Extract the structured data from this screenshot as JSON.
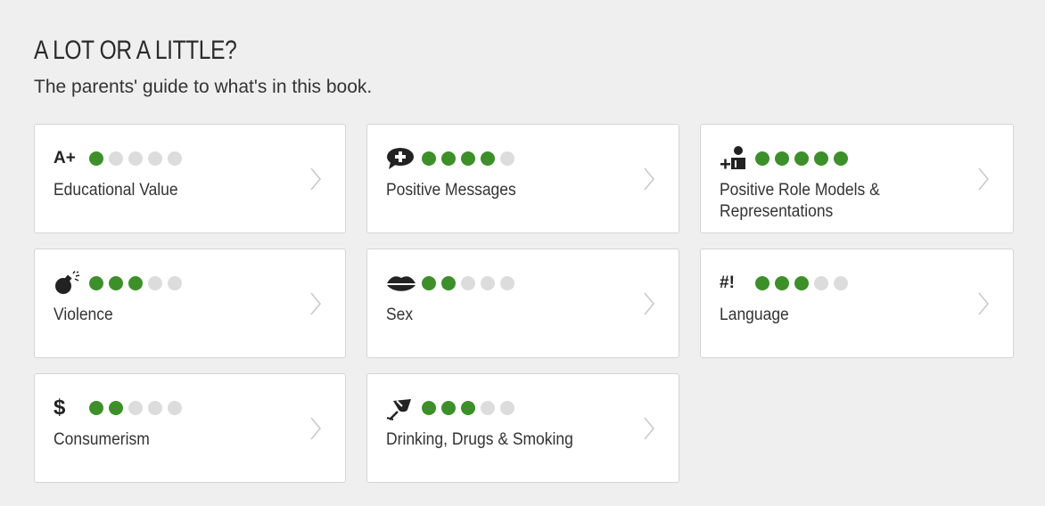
{
  "header": {
    "title": "A LOT OR A LITTLE?",
    "subtitle": "The parents' guide to what's in this book."
  },
  "colors": {
    "dot_on": "#3d8f2a",
    "dot_off": "#dcdcdc",
    "card_bg": "#ffffff",
    "page_bg": "#efefef"
  },
  "categories": [
    {
      "label": "Educational Value",
      "icon_text": "A+",
      "icon": "educational-value-icon",
      "rating": 1,
      "max": 5
    },
    {
      "label": "Positive Messages",
      "icon_text": "",
      "icon": "speech-bubble-plus-icon",
      "rating": 4,
      "max": 5
    },
    {
      "label": "Positive Role Models & Representations",
      "icon_text": "",
      "icon": "person-plus-icon",
      "rating": 5,
      "max": 5
    },
    {
      "label": "Violence",
      "icon_text": "",
      "icon": "bomb-icon",
      "rating": 3,
      "max": 5
    },
    {
      "label": "Sex",
      "icon_text": "",
      "icon": "lips-icon",
      "rating": 2,
      "max": 5
    },
    {
      "label": "Language",
      "icon_text": "#!",
      "icon": "language-icon",
      "rating": 3,
      "max": 5
    },
    {
      "label": "Consumerism",
      "icon_text": "$",
      "icon": "dollar-icon",
      "rating": 2,
      "max": 5
    },
    {
      "label": "Drinking, Drugs & Smoking",
      "icon_text": "",
      "icon": "cocktail-glass-icon",
      "rating": 3,
      "max": 5
    }
  ]
}
